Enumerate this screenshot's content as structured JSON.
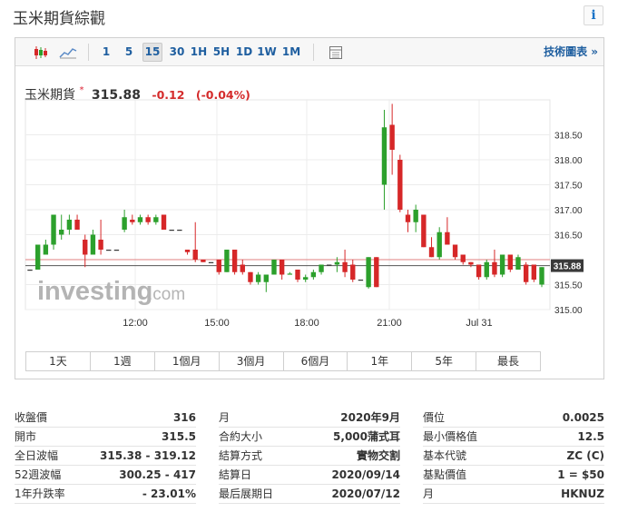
{
  "page": {
    "title": "玉米期貨綜觀"
  },
  "toolbar": {
    "intervals": [
      "1",
      "5",
      "15",
      "30",
      "1H",
      "5H",
      "1D",
      "1W",
      "1M"
    ],
    "active_interval": "15",
    "tech_chart_label": "技術圖表 »"
  },
  "quote": {
    "name": "玉米期貨",
    "star": "*",
    "price": "315.88",
    "change": "-0.12",
    "change_pct": "(-0.04%)"
  },
  "watermark": {
    "brand": "investing",
    "suffix": ".com"
  },
  "colors": {
    "up": "#2ca02c",
    "down": "#d62728",
    "price_tag": "#3a3a3a",
    "accent_link": "#1f5fa0"
  },
  "chart_data": {
    "type": "candlestick",
    "x_tick_labels": [
      "12:00",
      "15:00",
      "18:00",
      "21:00",
      "Jul 31"
    ],
    "y_tick_labels": [
      "318.50",
      "318.00",
      "317.50",
      "317.00",
      "316.50",
      "315.50",
      "315.00"
    ],
    "ylim": [
      315.0,
      319.2
    ],
    "current_price_label": "315.88",
    "reference_lines": [
      316.0,
      315.88
    ],
    "grid": true,
    "candles": [
      [
        315.8,
        315.8,
        315.8,
        315.8
      ],
      [
        315.8,
        316.3,
        315.8,
        316.3
      ],
      [
        316.1,
        316.4,
        316.1,
        316.3
      ],
      [
        316.3,
        316.9,
        316.2,
        316.9
      ],
      [
        316.5,
        316.9,
        316.4,
        316.6
      ],
      [
        316.6,
        316.9,
        316.5,
        316.8
      ],
      [
        316.8,
        316.9,
        316.6,
        316.6
      ],
      [
        316.4,
        316.5,
        315.85,
        316.1
      ],
      [
        316.1,
        316.6,
        316.1,
        316.5
      ],
      [
        316.4,
        316.8,
        316.1,
        316.2
      ],
      [
        316.2,
        316.2,
        316.2,
        316.2
      ],
      [
        316.2,
        316.2,
        316.2,
        316.2
      ],
      [
        316.6,
        317.0,
        316.55,
        316.85
      ],
      [
        316.8,
        316.9,
        316.7,
        316.75
      ],
      [
        316.75,
        316.9,
        316.7,
        316.85
      ],
      [
        316.85,
        316.9,
        316.7,
        316.75
      ],
      [
        316.75,
        316.9,
        316.7,
        316.85
      ],
      [
        316.9,
        316.9,
        316.6,
        316.6
      ],
      [
        316.6,
        316.6,
        316.6,
        316.6
      ],
      [
        316.6,
        316.6,
        316.6,
        316.6
      ],
      [
        316.2,
        316.2,
        316.1,
        316.15
      ],
      [
        316.2,
        316.75,
        315.95,
        316.0
      ],
      [
        316.0,
        316.0,
        315.95,
        315.95
      ],
      [
        315.95,
        315.95,
        315.95,
        315.95
      ],
      [
        316.0,
        316.0,
        315.7,
        315.75
      ],
      [
        315.75,
        316.2,
        315.75,
        316.2
      ],
      [
        316.2,
        316.2,
        315.7,
        315.75
      ],
      [
        315.9,
        316.0,
        315.7,
        315.75
      ],
      [
        315.75,
        315.75,
        315.5,
        315.55
      ],
      [
        315.55,
        315.75,
        315.5,
        315.7
      ],
      [
        315.55,
        315.7,
        315.35,
        315.7
      ],
      [
        315.7,
        316.0,
        315.7,
        316.0
      ],
      [
        316.0,
        316.0,
        315.6,
        315.7
      ],
      [
        315.7,
        315.75,
        315.7,
        315.72
      ],
      [
        315.8,
        315.8,
        315.55,
        315.6
      ],
      [
        315.6,
        315.7,
        315.55,
        315.65
      ],
      [
        315.65,
        315.8,
        315.6,
        315.75
      ],
      [
        315.75,
        315.9,
        315.7,
        315.9
      ],
      [
        315.9,
        315.9,
        315.9,
        315.9
      ],
      [
        315.9,
        316.05,
        315.75,
        315.95
      ],
      [
        315.95,
        316.2,
        315.65,
        315.75
      ],
      [
        315.9,
        316.0,
        315.55,
        315.6
      ],
      [
        315.6,
        315.6,
        315.6,
        315.6
      ],
      [
        315.45,
        316.05,
        315.42,
        316.05
      ],
      [
        316.05,
        316.05,
        315.45,
        315.45
      ],
      [
        317.5,
        319.0,
        317.0,
        318.65
      ],
      [
        318.7,
        319.12,
        317.7,
        318.2
      ],
      [
        318.0,
        318.1,
        316.95,
        317.0
      ],
      [
        316.9,
        317.0,
        316.55,
        316.75
      ],
      [
        316.75,
        317.1,
        316.55,
        317.0
      ],
      [
        316.9,
        316.9,
        316.25,
        316.25
      ],
      [
        316.25,
        316.45,
        316.05,
        316.05
      ],
      [
        316.05,
        316.65,
        316.0,
        316.55
      ],
      [
        316.55,
        316.85,
        316.3,
        316.3
      ],
      [
        316.3,
        316.3,
        316.0,
        316.05
      ],
      [
        316.1,
        316.1,
        315.9,
        315.95
      ],
      [
        315.95,
        315.95,
        315.85,
        315.9
      ],
      [
        315.9,
        315.9,
        315.6,
        315.65
      ],
      [
        315.65,
        316.0,
        315.6,
        315.95
      ],
      [
        315.95,
        316.2,
        315.65,
        315.7
      ],
      [
        315.7,
        316.1,
        315.65,
        316.1
      ],
      [
        316.1,
        316.1,
        315.75,
        315.8
      ],
      [
        315.8,
        316.1,
        315.8,
        316.05
      ],
      [
        315.9,
        315.95,
        315.5,
        315.55
      ],
      [
        315.9,
        315.9,
        315.55,
        315.6
      ],
      [
        315.5,
        315.85,
        315.45,
        315.85
      ]
    ]
  },
  "ranges": [
    "1天",
    "1週",
    "1個月",
    "3個月",
    "6個月",
    "1年",
    "5年",
    "最長"
  ],
  "stats": {
    "col1": [
      {
        "label": "收盤價",
        "value": "316"
      },
      {
        "label": "開市",
        "value": "315.5"
      },
      {
        "label": "全日波幅",
        "value": "315.38 - 319.12"
      },
      {
        "label": "52週波幅",
        "value": "300.25 - 417"
      },
      {
        "label": "1年升跌率",
        "value": "- 23.01%"
      }
    ],
    "col2": [
      {
        "label": "月",
        "value": "2020年9月"
      },
      {
        "label": "合約大小",
        "value": "5,000蒲式耳"
      },
      {
        "label": "結算方式",
        "value": "實物交割"
      },
      {
        "label": "結算日",
        "value": "2020/09/14"
      },
      {
        "label": "最后展期日",
        "value": "2020/07/12"
      }
    ],
    "col3": [
      {
        "label": "價位",
        "value": "0.0025"
      },
      {
        "label": "最小價格值",
        "value": "12.5"
      },
      {
        "label": "基本代號",
        "value": "ZC (C)"
      },
      {
        "label": "基點價值",
        "value": "1 = $50"
      },
      {
        "label": "月",
        "value": "HKNUZ"
      }
    ]
  }
}
